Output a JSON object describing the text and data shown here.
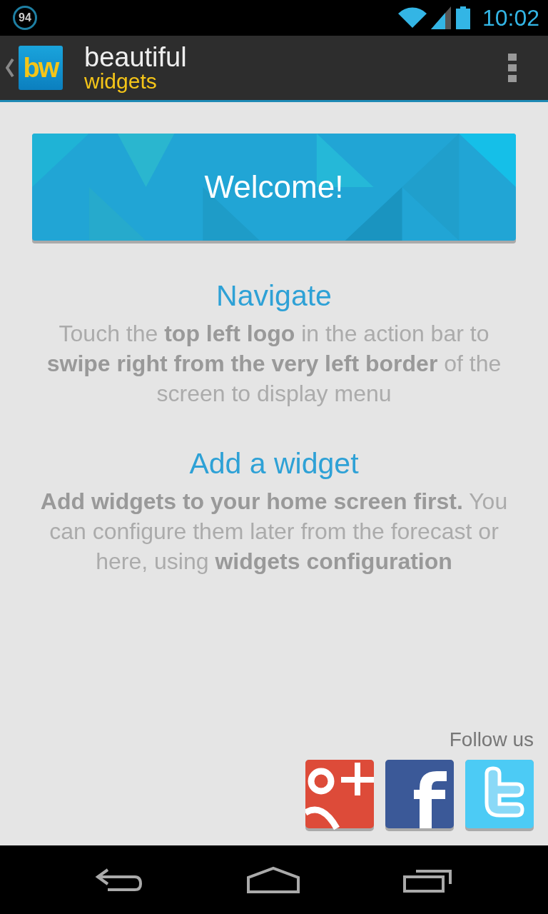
{
  "status_bar": {
    "battery_badge": "94",
    "time": "10:02"
  },
  "action_bar": {
    "logo": "bw",
    "title": "beautiful",
    "subtitle": "widgets"
  },
  "banner": {
    "title": "Welcome!"
  },
  "sections": [
    {
      "heading": "Navigate",
      "text": "Touch the **top left logo** in the action bar to **swipe right from the very left border** of the screen to display menu"
    },
    {
      "heading": "Add a widget",
      "text": "**Add widgets to your home screen first.** You can configure them later from the forecast or here, using **widgets configuration**"
    }
  ],
  "follow": {
    "label": "Follow us",
    "networks": [
      {
        "kind": "gplus"
      },
      {
        "kind": "facebook"
      },
      {
        "kind": "twitter"
      }
    ]
  }
}
